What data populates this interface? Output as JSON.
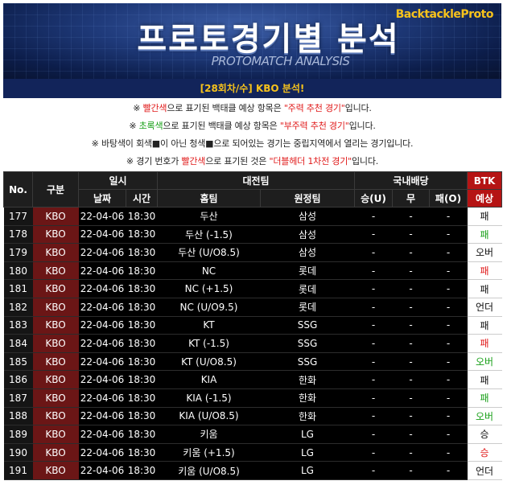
{
  "banner": {
    "title": "프로토경기별 분석",
    "subtitle": "PROTOMATCH ANALYSIS",
    "brand": "BacktackleProto"
  },
  "info_title": "[28회차/수] KBO 분석!",
  "notes": [
    {
      "prefix": "※ ",
      "colored": "빨간색",
      "color": "red",
      "mid": "으로 표기된 백태클 예상 항목은 ",
      "quoted": "\"주력 추천 경기\"",
      "suffix": "입니다."
    },
    {
      "prefix": "※ ",
      "colored": "초록색",
      "color": "green",
      "mid": "으로 표기된 백태클 예상 항목은 ",
      "quoted": "\"부주력 추천 경기\"",
      "suffix": "입니다."
    },
    {
      "text": "※ 바탕색이 회색■이 아닌 청색■으로 되어있는 경기는 중립지역에서 열리는 경기입니다."
    },
    {
      "prefix": "※ 경기 번호가 ",
      "colored": "빨간색",
      "color": "red",
      "mid": "으로 표기된 것은 ",
      "quoted": "\"더블헤더 1차전 경기\"",
      "suffix": "입니다."
    }
  ],
  "table": {
    "headers": {
      "no": "No.",
      "kind": "구분",
      "datetime": "일시",
      "date": "날짜",
      "time": "시간",
      "match": "대전팀",
      "home": "홈팀",
      "away": "원정팀",
      "odds": "국내배당",
      "win": "승(U)",
      "draw": "무",
      "lose": "패(O)",
      "btk_top": "BTK",
      "btk_bottom": "예상"
    },
    "rows": [
      {
        "no": "177",
        "kind": "KBO",
        "date": "22-04-06",
        "time": "18:30",
        "home": "두산",
        "away": "삼성",
        "win": "-",
        "draw": "-",
        "lose": "-",
        "btk": "패",
        "btk_color": "black"
      },
      {
        "no": "178",
        "kind": "KBO",
        "date": "22-04-06",
        "time": "18:30",
        "home": "두산 (-1.5)",
        "away": "삼성",
        "win": "-",
        "draw": "-",
        "lose": "-",
        "btk": "패",
        "btk_color": "green"
      },
      {
        "no": "179",
        "kind": "KBO",
        "date": "22-04-06",
        "time": "18:30",
        "home": "두산 (U/O8.5)",
        "away": "삼성",
        "win": "-",
        "draw": "-",
        "lose": "-",
        "btk": "오버",
        "btk_color": "black"
      },
      {
        "no": "180",
        "kind": "KBO",
        "date": "22-04-06",
        "time": "18:30",
        "home": "NC",
        "away": "롯데",
        "win": "-",
        "draw": "-",
        "lose": "-",
        "btk": "패",
        "btk_color": "red"
      },
      {
        "no": "181",
        "kind": "KBO",
        "date": "22-04-06",
        "time": "18:30",
        "home": "NC (+1.5)",
        "away": "롯데",
        "win": "-",
        "draw": "-",
        "lose": "-",
        "btk": "패",
        "btk_color": "black"
      },
      {
        "no": "182",
        "kind": "KBO",
        "date": "22-04-06",
        "time": "18:30",
        "home": "NC (U/O9.5)",
        "away": "롯데",
        "win": "-",
        "draw": "-",
        "lose": "-",
        "btk": "언더",
        "btk_color": "black"
      },
      {
        "no": "183",
        "kind": "KBO",
        "date": "22-04-06",
        "time": "18:30",
        "home": "KT",
        "away": "SSG",
        "win": "-",
        "draw": "-",
        "lose": "-",
        "btk": "패",
        "btk_color": "black"
      },
      {
        "no": "184",
        "kind": "KBO",
        "date": "22-04-06",
        "time": "18:30",
        "home": "KT (-1.5)",
        "away": "SSG",
        "win": "-",
        "draw": "-",
        "lose": "-",
        "btk": "패",
        "btk_color": "red"
      },
      {
        "no": "185",
        "kind": "KBO",
        "date": "22-04-06",
        "time": "18:30",
        "home": "KT (U/O8.5)",
        "away": "SSG",
        "win": "-",
        "draw": "-",
        "lose": "-",
        "btk": "오버",
        "btk_color": "green"
      },
      {
        "no": "186",
        "kind": "KBO",
        "date": "22-04-06",
        "time": "18:30",
        "home": "KIA",
        "away": "한화",
        "win": "-",
        "draw": "-",
        "lose": "-",
        "btk": "패",
        "btk_color": "black"
      },
      {
        "no": "187",
        "kind": "KBO",
        "date": "22-04-06",
        "time": "18:30",
        "home": "KIA (-1.5)",
        "away": "한화",
        "win": "-",
        "draw": "-",
        "lose": "-",
        "btk": "패",
        "btk_color": "green"
      },
      {
        "no": "188",
        "kind": "KBO",
        "date": "22-04-06",
        "time": "18:30",
        "home": "KIA (U/O8.5)",
        "away": "한화",
        "win": "-",
        "draw": "-",
        "lose": "-",
        "btk": "오버",
        "btk_color": "green"
      },
      {
        "no": "189",
        "kind": "KBO",
        "date": "22-04-06",
        "time": "18:30",
        "home": "키움",
        "away": "LG",
        "win": "-",
        "draw": "-",
        "lose": "-",
        "btk": "승",
        "btk_color": "black"
      },
      {
        "no": "190",
        "kind": "KBO",
        "date": "22-04-06",
        "time": "18:30",
        "home": "키움 (+1.5)",
        "away": "LG",
        "win": "-",
        "draw": "-",
        "lose": "-",
        "btk": "승",
        "btk_color": "red"
      },
      {
        "no": "191",
        "kind": "KBO",
        "date": "22-04-06",
        "time": "18:30",
        "home": "키움 (U/O8.5)",
        "away": "LG",
        "win": "-",
        "draw": "-",
        "lose": "-",
        "btk": "언더",
        "btk_color": "black"
      }
    ]
  }
}
